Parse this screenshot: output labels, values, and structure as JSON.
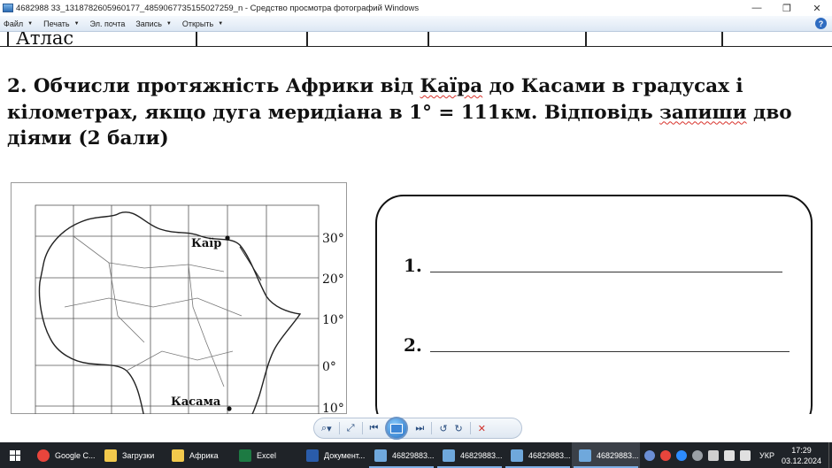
{
  "window": {
    "title": "4682988 33_1318782605960177_4859067735155027259_n - Средство просмотра фотографий Windows",
    "minimize": "—",
    "restore": "❐",
    "close": "✕"
  },
  "menu": {
    "items": [
      {
        "label": "Файл",
        "has_arrow": true
      },
      {
        "label": "Печать",
        "has_arrow": true
      },
      {
        "label": "Эл. почта",
        "has_arrow": false
      },
      {
        "label": "Запись",
        "has_arrow": true
      },
      {
        "label": "Открыть",
        "has_arrow": true
      }
    ],
    "arrow": "▼",
    "help": "?"
  },
  "photo": {
    "table_cell_text": "Атлас",
    "question": {
      "line1_a": "2. Обчисли протяжність Африки від ",
      "line1_spell": "Каїра",
      "line1_b": " до Касами в градусах і",
      "line2_a": "кілометрах, якщо дуга меридіана в 1° = 111км. Відповідь ",
      "line2_spell": "запиши",
      "line2_b": " дво",
      "line3": "діями (2 бали)"
    },
    "map": {
      "city_north": "Каїр",
      "city_south": "Касама",
      "lat_labels": [
        "30°",
        "20°",
        "10°",
        "0°",
        "10°"
      ]
    },
    "answers": [
      {
        "num": "1."
      },
      {
        "num": "2."
      }
    ]
  },
  "viewer_toolbar": {
    "zoom": "⌕",
    "zoom_arrow": "▾",
    "fit": "⤢",
    "prev": "⏮",
    "next": "⏭",
    "rotate_ccw": "↺",
    "rotate_cw": "↻",
    "delete": "✕"
  },
  "taskbar": {
    "tasks": [
      {
        "label": "Google C...",
        "color": "#e8453c"
      },
      {
        "label": "Загрузки",
        "color": "#f2c94c"
      },
      {
        "label": "Африка",
        "color": "#f2c94c"
      },
      {
        "label": "Excel",
        "color": "#1d7a43"
      },
      {
        "label": "Документ...",
        "color": "#2a5caa"
      },
      {
        "label": "46829883...",
        "color": "#6fa8dc"
      },
      {
        "label": "46829883...",
        "color": "#6fa8dc"
      },
      {
        "label": "46829883...",
        "color": "#6fa8dc"
      },
      {
        "label": "46829883...",
        "color": "#6fa8dc"
      }
    ],
    "language": "УКР",
    "time": "17:29",
    "date": "03.12.2024"
  }
}
